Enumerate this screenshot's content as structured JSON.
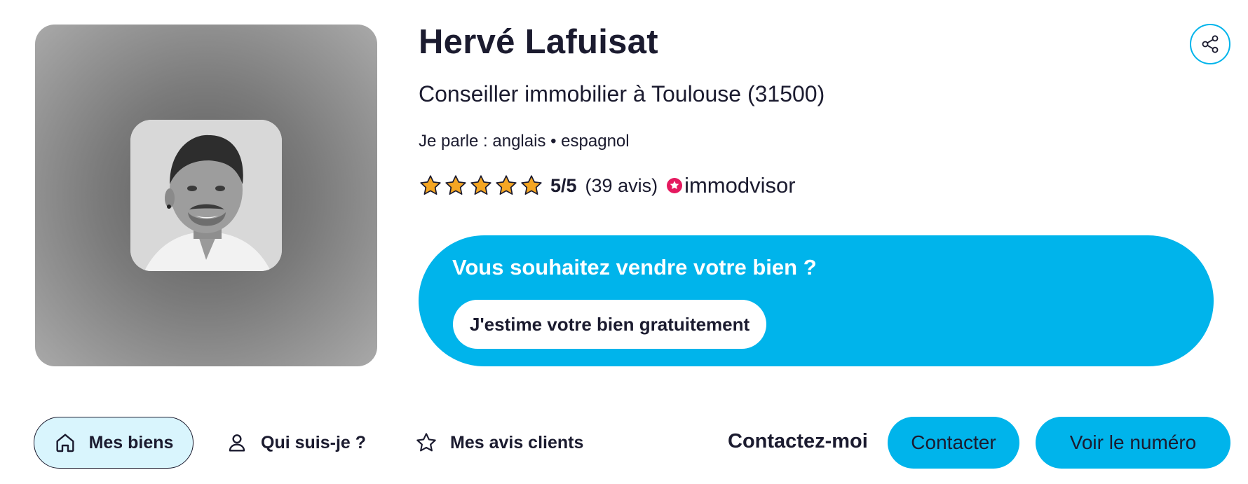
{
  "agent": {
    "name": "Hervé Lafuisat",
    "title": "Conseiller immobilier à Toulouse (31500)",
    "languages": "Je parle : anglais • espagnol"
  },
  "rating": {
    "stars_filled": 5,
    "stars_total": 5,
    "score": "5/5",
    "reviews": "(39 avis)",
    "provider": "immodvisor",
    "star_color": "#f5a623"
  },
  "share": {
    "icon": "share-icon"
  },
  "sell_banner": {
    "title": "Vous souhaitez vendre votre bien ?",
    "button_label": "J'estime votre bien gratuitement",
    "color": "#00b4eb"
  },
  "nav": {
    "tabs": [
      {
        "label": "Mes biens",
        "icon": "home-icon",
        "active": true
      },
      {
        "label": "Qui suis-je ?",
        "icon": "user-icon",
        "active": false
      },
      {
        "label": "Mes avis clients",
        "icon": "star-outline-icon",
        "active": false
      }
    ],
    "contact_label": "Contactez-moi",
    "contact_button": "Contacter",
    "phone_button": "Voir le numéro"
  }
}
